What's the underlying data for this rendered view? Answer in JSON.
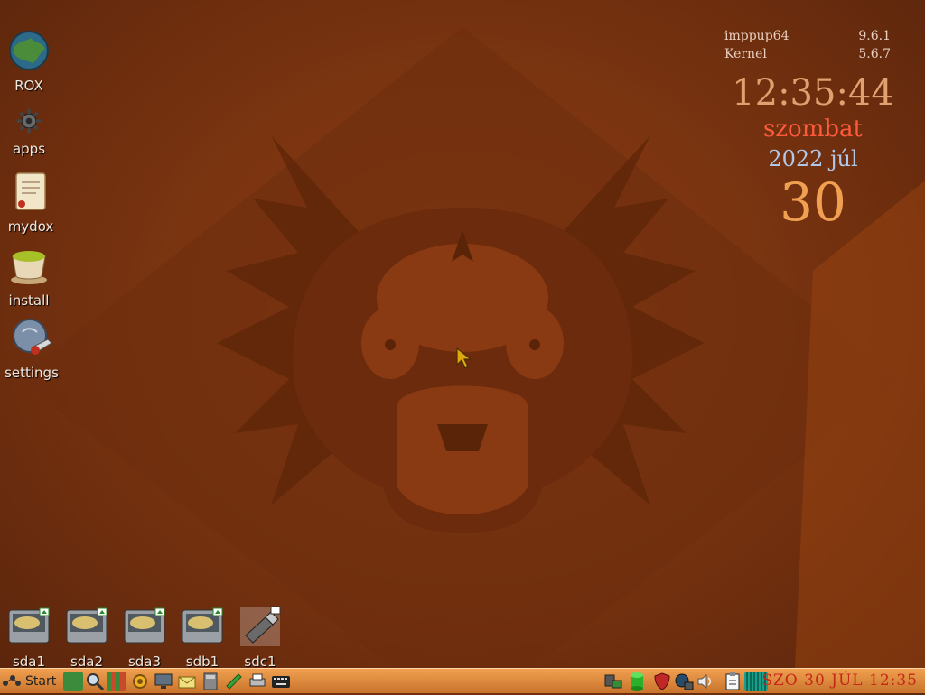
{
  "desktop_icons": [
    {
      "label": "ROX",
      "icon": "rox-globe-icon"
    },
    {
      "label": "apps",
      "icon": "apps-gear-icon"
    },
    {
      "label": "mydox",
      "icon": "document-scroll-icon"
    },
    {
      "label": "install",
      "icon": "tea-cup-icon"
    },
    {
      "label": "settings",
      "icon": "settings-wrench-globe-icon"
    }
  ],
  "drives": [
    {
      "label": "sda1",
      "icon": "hard-drive-icon"
    },
    {
      "label": "sda2",
      "icon": "hard-drive-icon"
    },
    {
      "label": "sda3",
      "icon": "hard-drive-icon"
    },
    {
      "label": "sdb1",
      "icon": "hard-drive-icon"
    },
    {
      "label": "sdc1",
      "icon": "usb-drive-icon"
    }
  ],
  "sysinfo": {
    "distro_label": "imppup64",
    "distro_version": "9.6.1",
    "kernel_label": "Kernel",
    "kernel_version": "5.6.7"
  },
  "clock": {
    "time": "12:35:44",
    "weekday": "szombat",
    "year_month": "2022 júl",
    "day": "30"
  },
  "taskbar": {
    "start_label": "Start",
    "tray_clock": "SZO 30 JÚL 12:35"
  },
  "colors": {
    "taskbar": "#e08a3c",
    "clock_time": "#e0a070",
    "weekday": "#ff5a3c",
    "year_month": "#b0c8e8",
    "day": "#f0a050"
  }
}
